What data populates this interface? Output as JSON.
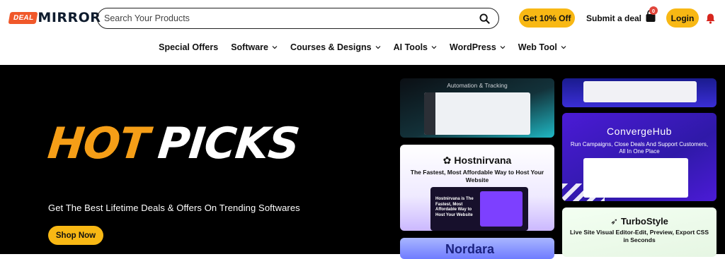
{
  "header": {
    "logo_badge": "DEAL",
    "logo_text": "MIRROR",
    "search_placeholder": "Search Your Products",
    "offer_label": "Get 10% Off",
    "submit_label": "Submit a deal",
    "cart_count": "0",
    "login_label": "Login",
    "accent_color": "#f8b814"
  },
  "nav": {
    "items": [
      {
        "label": "Special Offers",
        "dropdown": false
      },
      {
        "label": "Software",
        "dropdown": true
      },
      {
        "label": "Courses & Designs",
        "dropdown": true
      },
      {
        "label": "AI Tools",
        "dropdown": true
      },
      {
        "label": "WordPress",
        "dropdown": true
      },
      {
        "label": "Web Tool",
        "dropdown": true
      }
    ]
  },
  "hero": {
    "headline_1": "HOT",
    "headline_2": "PICKS",
    "tagline": "Get The Best Lifetime Deals & Offers On Trending Softwares",
    "cta_label": "Shop Now"
  },
  "cards": {
    "automation_caption": "Automation & Tracking",
    "hostnirvana_brand": "Hostnirvana",
    "hostnirvana_sub": "The Fastest, Most Affordable Way to Host Your Website",
    "hostnirvana_mock": "Hostnirvana is The Fastest, Most Affordable Way to Host Your Website",
    "partial_brand": "Nordara",
    "convergehub_brand": "ConvergeHub",
    "convergehub_sub": "Run Campaigns, Close Deals And Support Customers, All In One Place",
    "turbostyle_brand": "TurboStyle",
    "turbostyle_sub": "Live Site Visual Editor-Edit, Preview, Export CSS in Seconds"
  }
}
